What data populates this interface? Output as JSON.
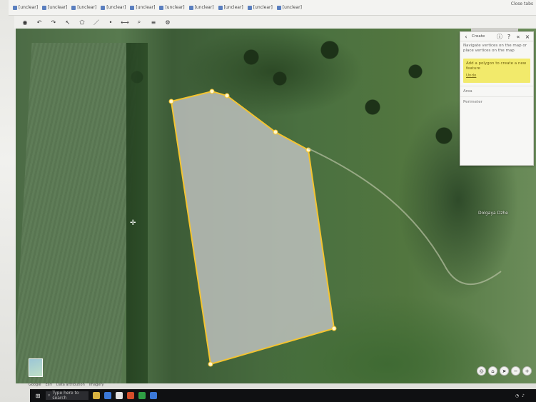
{
  "browser": {
    "bookmarks": [
      "[unclear]",
      "[unclear]",
      "[unclear]",
      "[unclear]",
      "[unclear]",
      "[unclear]",
      "[unclear]",
      "[unclear]",
      "[unclear]",
      "[unclear]"
    ],
    "close_label": "Close tabs"
  },
  "map": {
    "place_label": "Dolgaya Dzhe",
    "attribution": [
      "Google",
      "Esri",
      "Data attribution",
      "Imagery"
    ]
  },
  "panel": {
    "pill": "",
    "title": "Create",
    "description": "Navigate vertices on the map or place vertices on the map",
    "warning": "Add a polygon to create a new feature",
    "warning_link": "Undo",
    "field1_label": "Area",
    "field1_value": "",
    "field2_label": "Perimeter",
    "field2_value": ""
  },
  "taskbar": {
    "search_placeholder": "Type here to search",
    "time": "",
    "date": ""
  },
  "colors": {
    "parcel_stroke": "#f4c430",
    "parcel_fill": "#c8c8c8",
    "warning_bg": "#f2ea6b"
  }
}
